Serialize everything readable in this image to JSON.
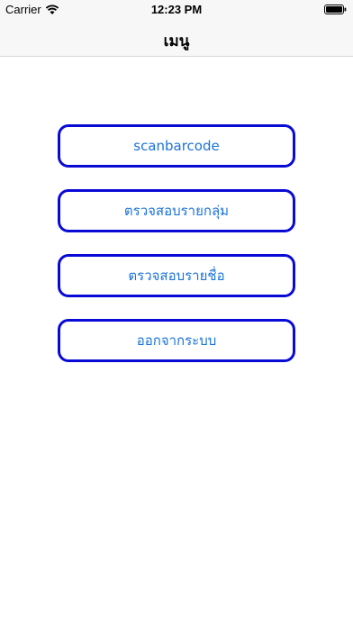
{
  "status_bar": {
    "carrier": "Carrier",
    "time": "12:23 PM",
    "wifi_icon": "wifi-icon",
    "battery_icon": "battery-icon"
  },
  "nav": {
    "title": "เมนู"
  },
  "menu": {
    "buttons": [
      {
        "label": "scanbarcode"
      },
      {
        "label": "ตรวจสอบรายกลุ่ม"
      },
      {
        "label": "ตรวจสอบรายชื่อ"
      },
      {
        "label": "ออกจากระบบ"
      }
    ]
  },
  "colors": {
    "button_border": "#0a0ad6",
    "button_text": "#1a73d9",
    "nav_background": "#f7f7f7"
  }
}
